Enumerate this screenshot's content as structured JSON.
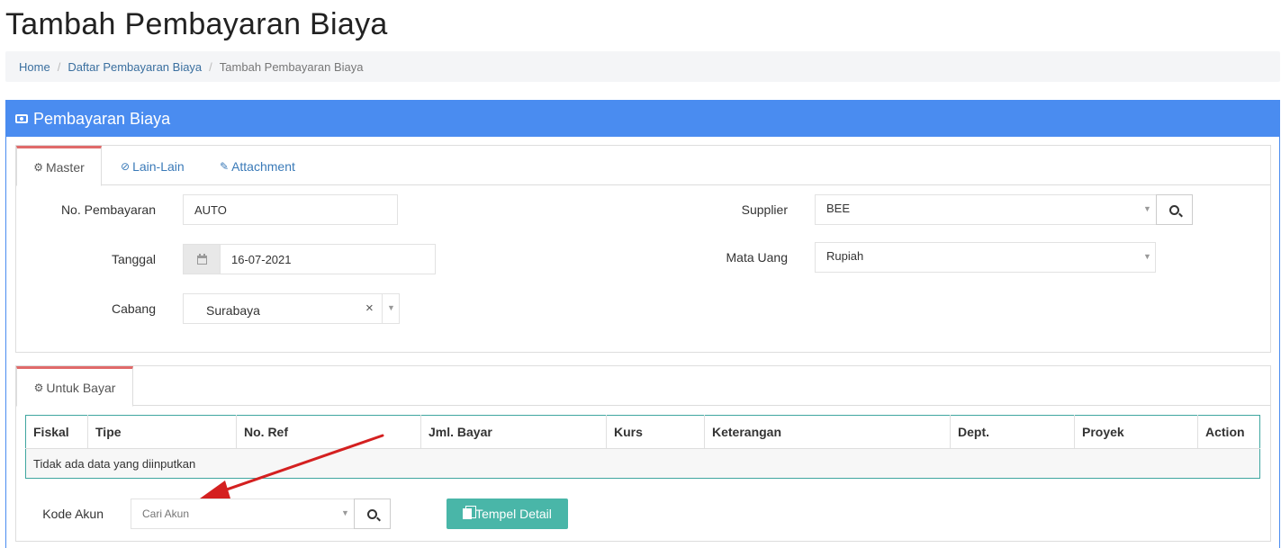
{
  "page_title": "Tambah Pembayaran Biaya",
  "breadcrumb": {
    "home": "Home",
    "list": "Daftar Pembayaran Biaya",
    "current": "Tambah Pembayaran Biaya",
    "sep": "/"
  },
  "panel_title": "Pembayaran Biaya",
  "master_tabs": [
    {
      "label": "Master",
      "icon": "gears-icon"
    },
    {
      "label": "Lain-Lain",
      "icon": "check-circle-icon"
    },
    {
      "label": "Attachment",
      "icon": "paperclip-icon"
    }
  ],
  "form": {
    "no_pembayaran_label": "No. Pembayaran",
    "no_pembayaran_value": "AUTO",
    "tanggal_label": "Tanggal",
    "tanggal_value": "16-07-2021",
    "cabang_label": "Cabang",
    "cabang_value": "Surabaya",
    "cabang_clear": "×",
    "supplier_label": "Supplier",
    "supplier_value": "BEE",
    "mata_uang_label": "Mata Uang",
    "mata_uang_value": "Rupiah"
  },
  "detail_tab": {
    "label": "Untuk Bayar",
    "icon": "gears-icon"
  },
  "table": {
    "columns": [
      "Fiskal",
      "Tipe",
      "No. Ref",
      "Jml. Bayar",
      "Kurs",
      "Keterangan",
      "Dept.",
      "Proyek",
      "Action"
    ],
    "empty_message": "Tidak ada data yang diinputkan"
  },
  "kode_akun": {
    "label": "Kode Akun",
    "placeholder": "Cari Akun"
  },
  "tempel_button": "Tempel Detail",
  "colors": {
    "panel_blue": "#4a8cf0",
    "tab_accent": "#e06a6a",
    "teal": "#49b6a8",
    "annotation_arrow": "#d42020"
  }
}
